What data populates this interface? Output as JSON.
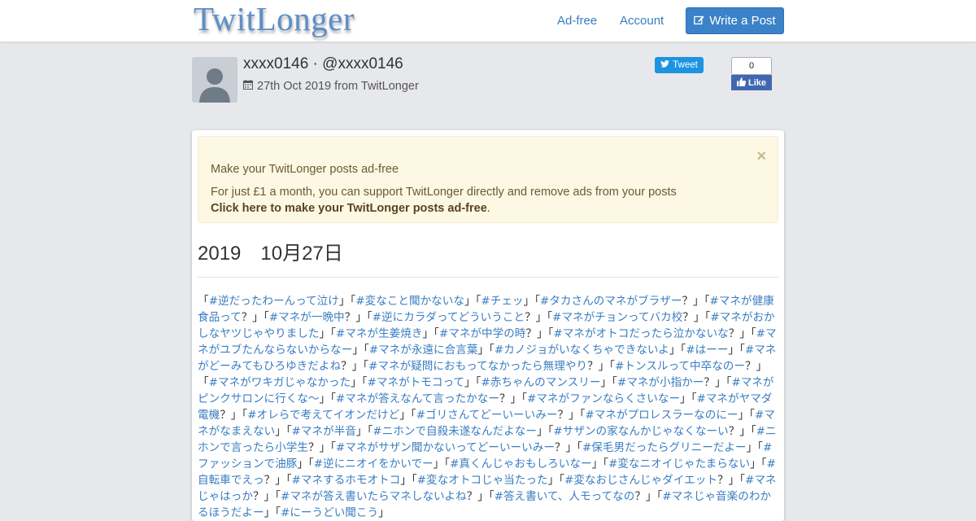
{
  "header": {
    "logo": "TwitLonger",
    "nav": [
      {
        "label": "Ad-free"
      },
      {
        "label": "Account"
      }
    ],
    "write_button": "Write a Post",
    "colors": {
      "accent": "#3b82c8",
      "logo": "#5b8fc9"
    }
  },
  "author": {
    "display": "xxxx0146 · @xxxx0146",
    "date": "27th Oct 2019 from TwitLonger"
  },
  "share": {
    "tweet_label": "Tweet",
    "fb_count": "0",
    "fb_like": "Like"
  },
  "notice": {
    "title": "Make your TwitLonger posts ad-free",
    "body": "For just £1 a month, you can support TwitLonger directly and remove ads from your posts",
    "link": "Click here to make your TwitLonger posts ad-free",
    "link_suffix": ".",
    "close": "×"
  },
  "post": {
    "title": "2019　10月27日",
    "tags": [
      "逆だったわーんって泣け",
      "変なこと聞かないな",
      "チェッ",
      "タカさんのマネがブラザー？",
      "マネが健康食品って？",
      "マネが一晩中？",
      "逆にカラダってどういうこと？",
      "マネがチョンってバカ校？",
      "マネがおかしなヤツじゃやりました",
      "マネが生姜焼き",
      "マネが中学の時？",
      "マネがオトコだったら泣かないな？",
      "マネがユブたんならないからなー",
      "マネが永遠に合言葉",
      "カノジョがいなくちゃできないよ",
      "はーー",
      "マネがどーみてもひろゆきだよね？",
      "マネが疑問におもってなかったら無理やり？",
      "トンスルって中卒なのー？",
      "マネがワキガじゃなかった",
      "マネがトモコって",
      "赤ちゃんのマンスリー",
      "マネが小指かー？",
      "マネがピンクサロンに行くな〜",
      "マネが答えなんて言ったかなー？",
      "マネがファンならくさいなー",
      "マネがヤマダ電機？",
      "オレらで考えてイオンだけど",
      "ゴリさんてどーいーいみー？",
      "マネがプロレスラーなのにー",
      "マネがなまえない",
      "マネが半音",
      "ニホンで自殺未遂なんだよなー",
      "サザンの家なんかじゃなくなーい？",
      "ニホンで言ったら小学生？",
      "マネがサザン聞かないってどーいーいみー？",
      "保毛男だったらグリニーだよー",
      "ファッションで油豚",
      "逆にニオイをかいでー",
      "真くんじゃおもしろいなー",
      "変なニオイじゃたまらない",
      "自転車でえっ？",
      "マネするホモオトコ",
      "変なオトコじゃ当たった",
      "変なおじさんじゃダイエット？",
      "マネじゃはっか？",
      "マネが答え書いたらマネしないよね？",
      "答え書いて、人モってなの？",
      "マネじゃ音楽のわかるほうだよー",
      "にーうどい聞こう"
    ]
  }
}
